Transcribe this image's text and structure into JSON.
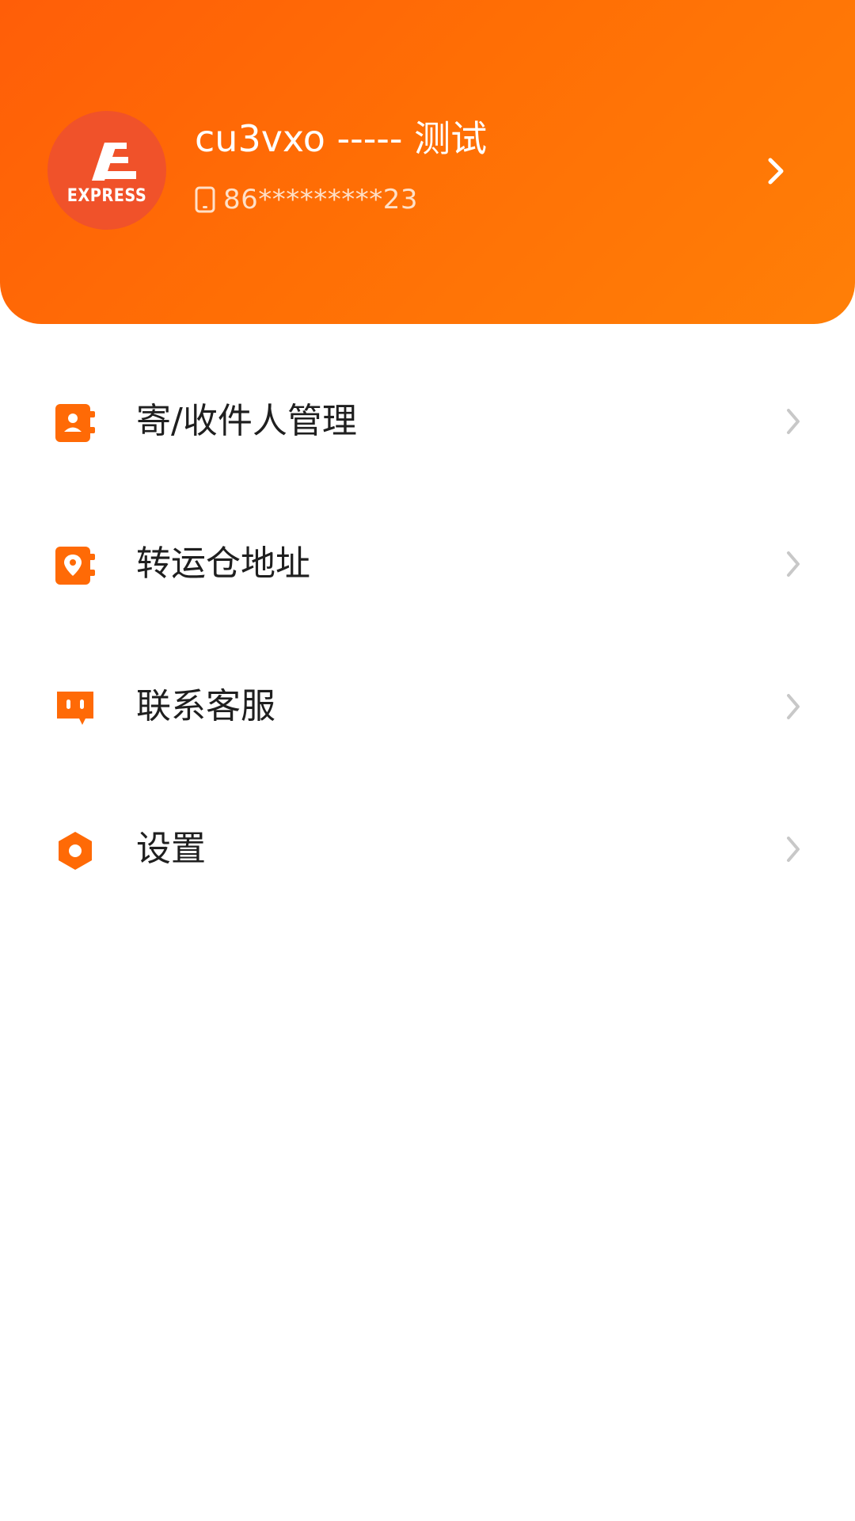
{
  "colors": {
    "accent": "#ff6a06",
    "avatar_bg": "#f0522a",
    "label_text": "#1f1f1f",
    "chevron_light": "#c8c8c8"
  },
  "header": {
    "avatar_label": "EXPRESS",
    "username": "cu3vxo ----- 测试",
    "phone": "86*********23",
    "phone_icon": "phone-icon",
    "chevron_icon": "chevron-right-icon"
  },
  "menu": {
    "items": [
      {
        "label": "寄/收件人管理",
        "icon": "contacts-icon"
      },
      {
        "label": "转运仓地址",
        "icon": "location-icon"
      },
      {
        "label": "联系客服",
        "icon": "chat-icon"
      },
      {
        "label": "设置",
        "icon": "settings-icon"
      }
    ]
  }
}
